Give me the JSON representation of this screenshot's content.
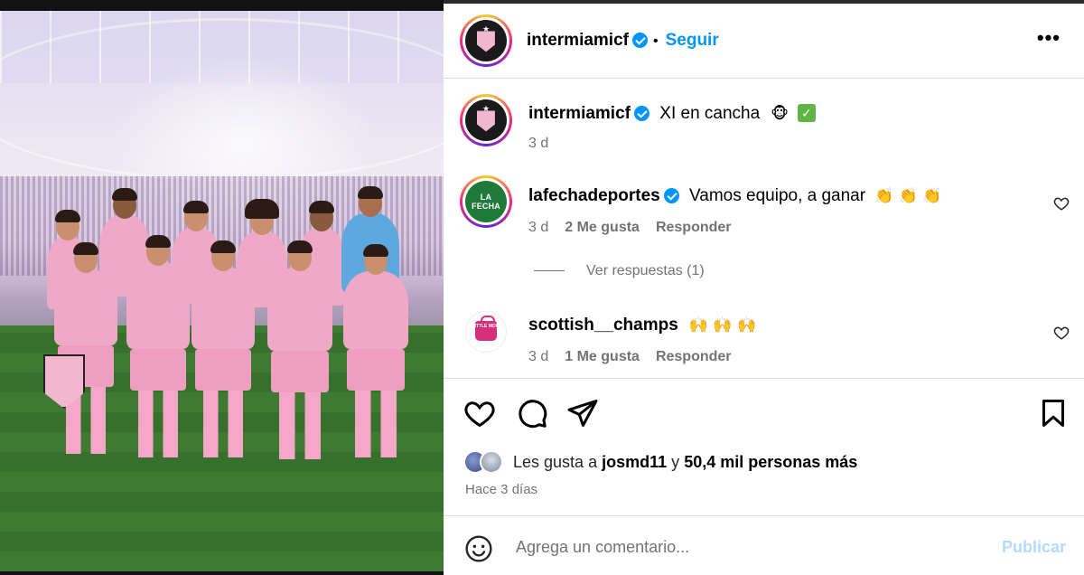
{
  "post": {
    "author": "intermiamicf",
    "follow_label": "Seguir",
    "separator": "•",
    "more_label": "•••",
    "caption_text": "XI en cancha",
    "caption_emoji": "🐵",
    "caption_check": "✓",
    "caption_time": "3 d"
  },
  "comments": [
    {
      "username": "lafechadeportes",
      "avatar_text": "LA FECHA",
      "text": "Vamos equipo, a ganar",
      "emojis": "👏 👏 👏",
      "time": "3 d",
      "likes": "2 Me gusta",
      "reply_label": "Responder",
      "view_replies": "Ver respuestas (1)"
    },
    {
      "username": "scottish__champs",
      "avatar_text": "LITTLE MOIE",
      "emojis": "🙌 🙌 🙌",
      "time": "3 d",
      "likes": "1 Me gusta",
      "reply_label": "Responder"
    }
  ],
  "likes_line": {
    "prefix": "Les gusta a",
    "user": "josmd11",
    "conj": "y",
    "count": "50,4 mil personas más"
  },
  "date_label": "Hace 3 días",
  "comment_input": {
    "placeholder": "Agrega un comentario...",
    "publish_label": "Publicar"
  },
  "colors": {
    "accent": "#0095f6",
    "publish_disabled": "#b3dbff",
    "jersey_pink": "#f0a8c7",
    "pitch_green": "#3f7a33"
  },
  "icons": [
    "verified-icon",
    "more-icon",
    "heart-icon",
    "comment-icon",
    "share-icon",
    "save-icon",
    "emoji-icon"
  ]
}
